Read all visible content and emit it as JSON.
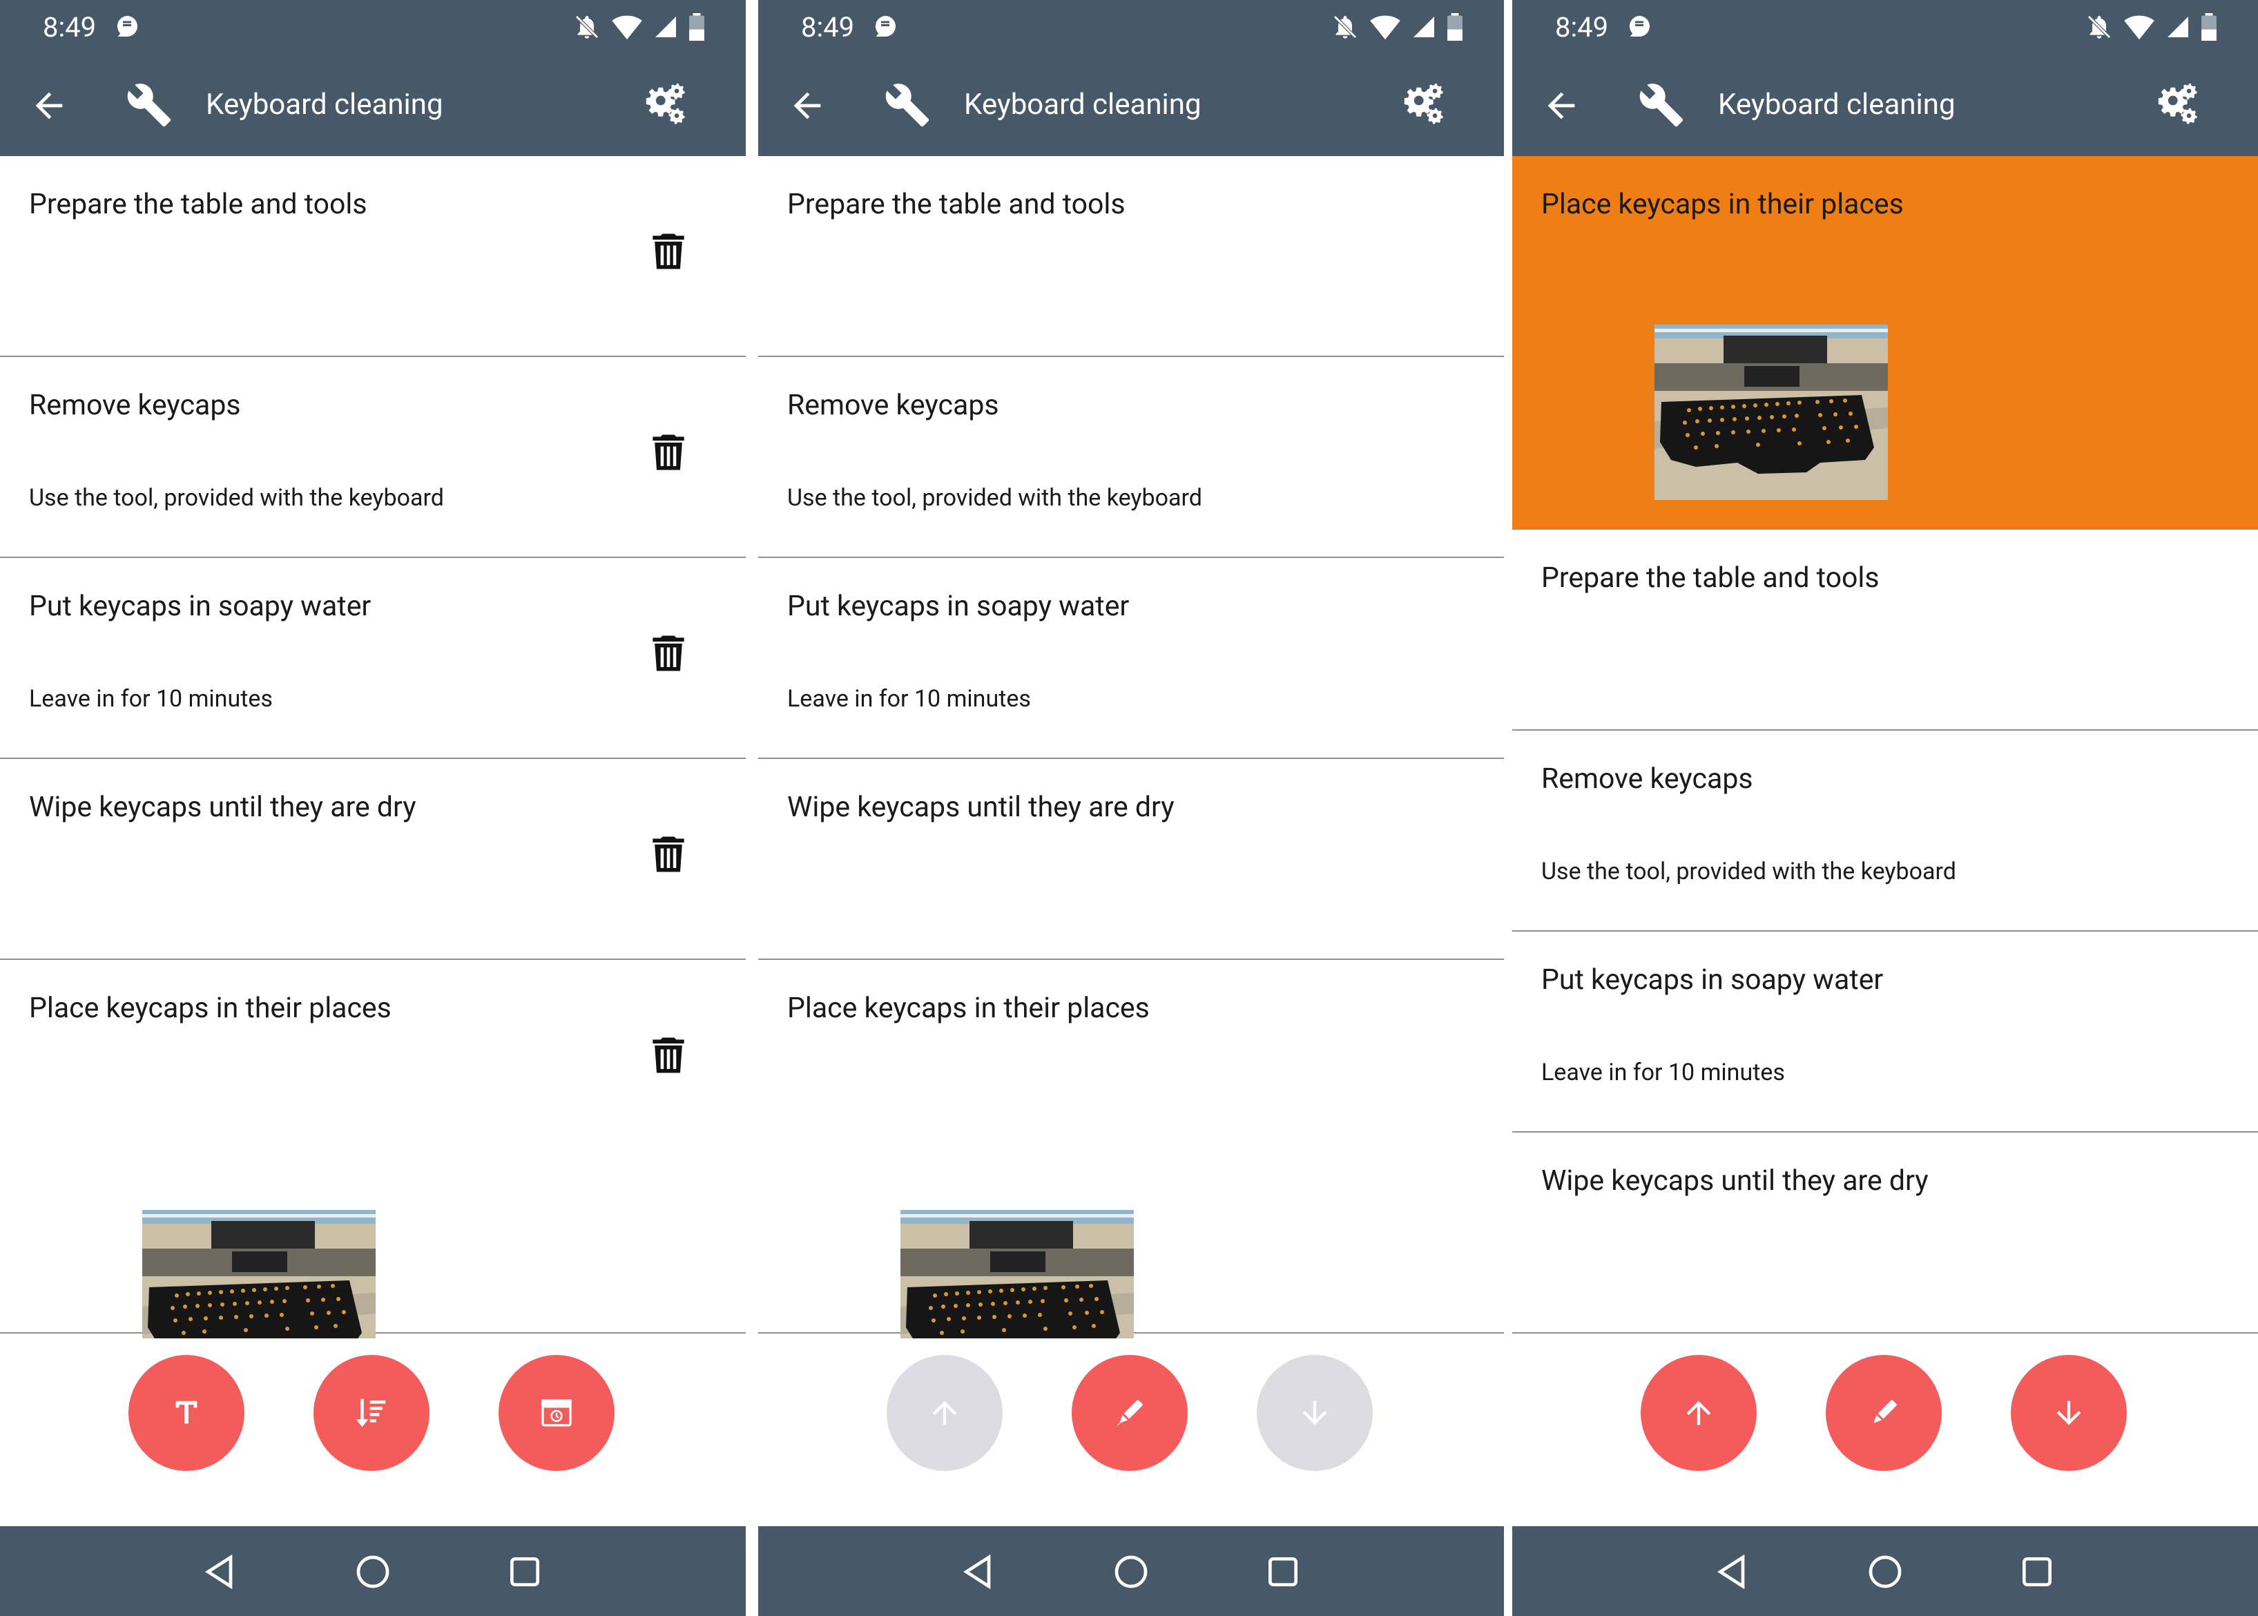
{
  "colors": {
    "bar": "#475868",
    "fab": "#f45b5b",
    "fab_disabled": "#dcdce2",
    "highlight": "#ef7e14"
  },
  "screens": [
    {
      "status_time": "8:49",
      "title": "Keyboard cleaning",
      "items": [
        {
          "title": "Prepare the table and tools",
          "desc": ""
        },
        {
          "title": "Remove keycaps",
          "desc": "Use the tool, provided with the keyboard"
        },
        {
          "title": "Put keycaps in soapy water",
          "desc": "Leave in for 10 minutes"
        },
        {
          "title": "Wipe keycaps until they are dry",
          "desc": ""
        },
        {
          "title": "Place keycaps in their places",
          "desc": ""
        }
      ],
      "fabs": [
        "text-icon",
        "sort-icon",
        "timer-icon"
      ]
    },
    {
      "status_time": "8:49",
      "title": "Keyboard cleaning",
      "items": [
        {
          "title": "Prepare the table and tools",
          "desc": ""
        },
        {
          "title": "Remove keycaps",
          "desc": "Use the tool, provided with the keyboard"
        },
        {
          "title": "Put keycaps in soapy water",
          "desc": "Leave in for 10 minutes"
        },
        {
          "title": "Wipe keycaps until they are dry",
          "desc": ""
        },
        {
          "title": "Place keycaps in their places",
          "desc": ""
        }
      ],
      "fabs": [
        "arrow-up-icon",
        "edit-icon",
        "arrow-down-icon"
      ]
    },
    {
      "status_time": "8:49",
      "title": "Keyboard cleaning",
      "items": [
        {
          "title": "Place keycaps in their places",
          "desc": ""
        },
        {
          "title": "Prepare the table and tools",
          "desc": ""
        },
        {
          "title": "Remove keycaps",
          "desc": "Use the tool, provided with the keyboard"
        },
        {
          "title": "Put keycaps in soapy water",
          "desc": "Leave in for 10 minutes"
        },
        {
          "title": "Wipe keycaps until they are dry",
          "desc": ""
        }
      ],
      "fabs": [
        "arrow-up-icon",
        "edit-icon",
        "arrow-down-icon"
      ]
    }
  ]
}
